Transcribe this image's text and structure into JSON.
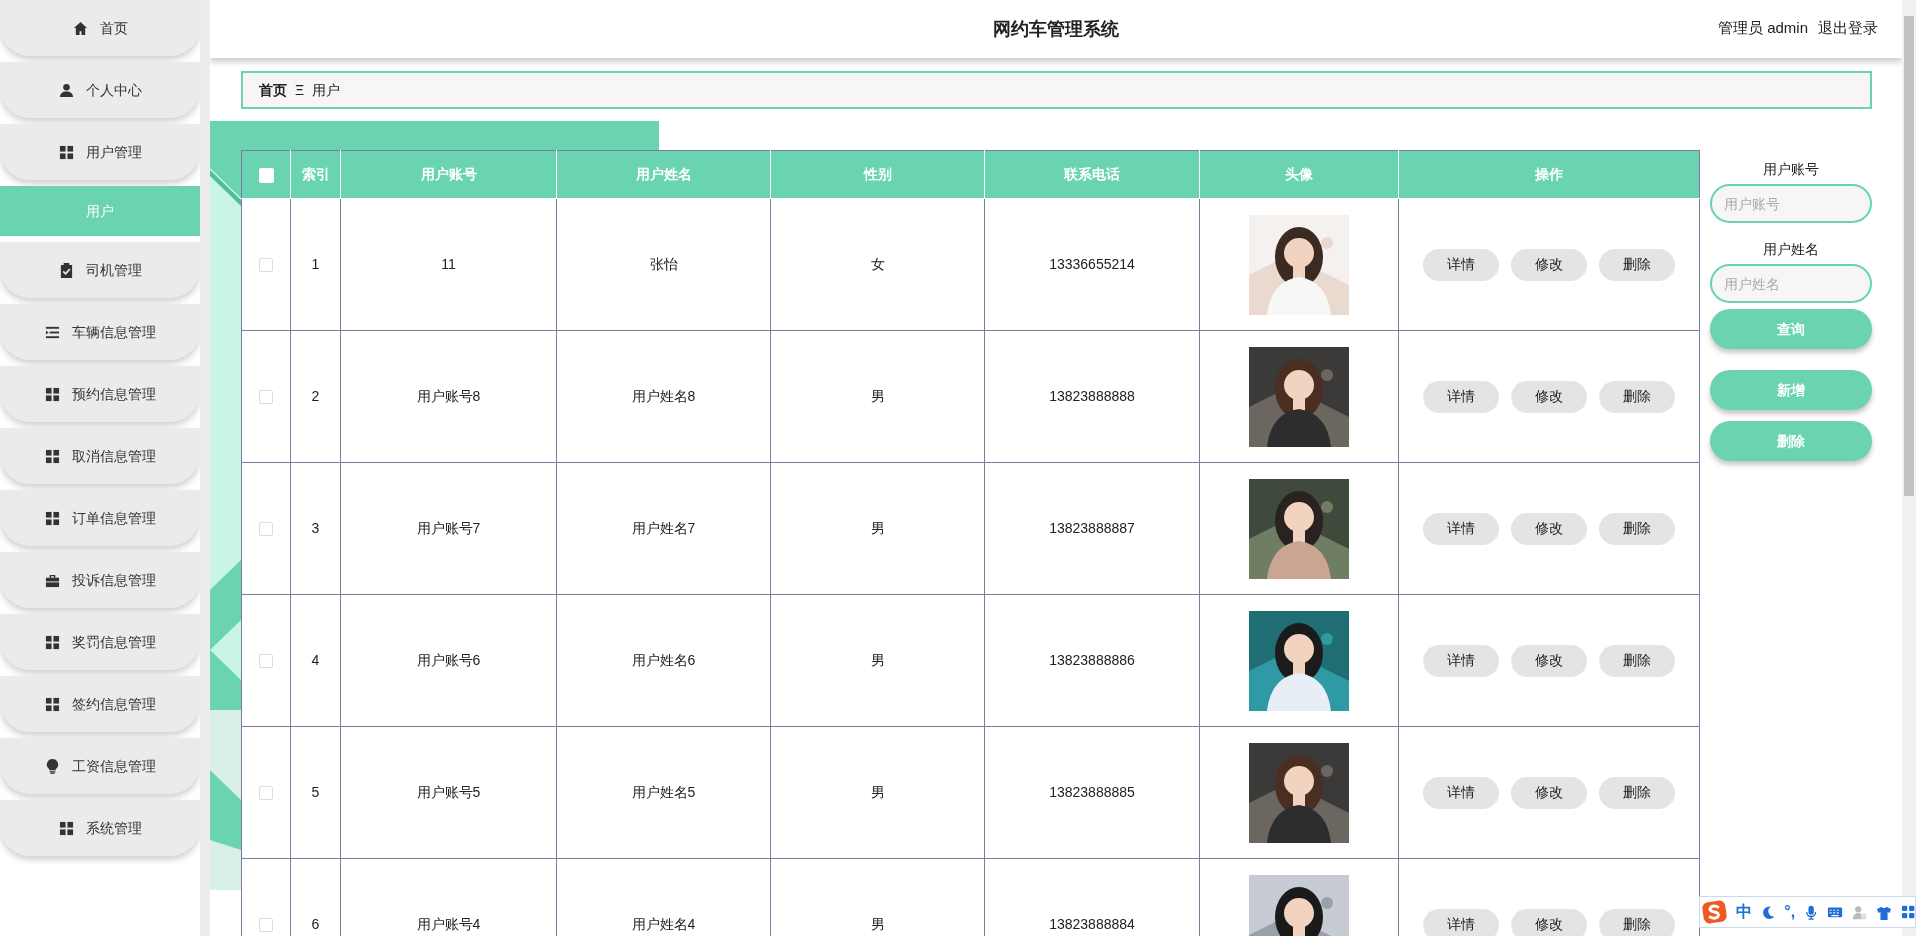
{
  "sidebar": {
    "items": [
      {
        "label": "首页",
        "kind": "home",
        "selected": false
      },
      {
        "label": "个人中心",
        "kind": "user",
        "selected": false
      },
      {
        "label": "用户管理",
        "kind": "grid",
        "selected": false
      },
      {
        "label": "用户",
        "kind": "sub",
        "selected": true
      },
      {
        "label": "司机管理",
        "kind": "clipboard",
        "selected": false
      },
      {
        "label": "车辆信息管理",
        "kind": "list",
        "selected": false
      },
      {
        "label": "预约信息管理",
        "kind": "grid",
        "selected": false
      },
      {
        "label": "取消信息管理",
        "kind": "grid",
        "selected": false
      },
      {
        "label": "订单信息管理",
        "kind": "grid",
        "selected": false
      },
      {
        "label": "投诉信息管理",
        "kind": "briefcase",
        "selected": false
      },
      {
        "label": "奖罚信息管理",
        "kind": "grid",
        "selected": false
      },
      {
        "label": "签约信息管理",
        "kind": "grid",
        "selected": false
      },
      {
        "label": "工资信息管理",
        "kind": "bulb",
        "selected": false
      },
      {
        "label": "系统管理",
        "kind": "grid",
        "selected": false
      }
    ]
  },
  "header": {
    "title": "网约车管理系统",
    "user": "管理员 admin",
    "logout": "退出登录"
  },
  "breadcrumb": {
    "home": "首页",
    "separator": "Ξ",
    "current": "用户"
  },
  "table": {
    "select_all": {
      "checked": false
    },
    "columns": [
      "索引",
      "用户账号",
      "用户姓名",
      "性别",
      "联系电话",
      "头像",
      "操作"
    ],
    "rows": [
      {
        "checked": false,
        "index": "1",
        "account": "11",
        "name": "张怡",
        "gender": "女",
        "phone": "13336655214",
        "actions": [
          "详情",
          "修改",
          "删除"
        ]
      },
      {
        "checked": false,
        "index": "2",
        "account": "用户账号8",
        "name": "用户姓名8",
        "gender": "男",
        "phone": "13823888888",
        "actions": [
          "详情",
          "修改",
          "删除"
        ]
      },
      {
        "checked": false,
        "index": "3",
        "account": "用户账号7",
        "name": "用户姓名7",
        "gender": "男",
        "phone": "13823888887",
        "actions": [
          "详情",
          "修改",
          "删除"
        ]
      },
      {
        "checked": false,
        "index": "4",
        "account": "用户账号6",
        "name": "用户姓名6",
        "gender": "男",
        "phone": "13823888886",
        "actions": [
          "详情",
          "修改",
          "删除"
        ]
      },
      {
        "checked": false,
        "index": "5",
        "account": "用户账号5",
        "name": "用户姓名5",
        "gender": "男",
        "phone": "13823888885",
        "actions": [
          "详情",
          "修改",
          "删除"
        ]
      },
      {
        "checked": false,
        "index": "6",
        "account": "用户账号4",
        "name": "用户姓名4",
        "gender": "男",
        "phone": "13823888884",
        "actions": [
          "详情",
          "修改",
          "删除"
        ]
      }
    ]
  },
  "search": {
    "fields": [
      {
        "label": "用户账号",
        "placeholder": "用户账号"
      },
      {
        "label": "用户姓名",
        "placeholder": "用户姓名"
      }
    ],
    "buttons": [
      "查询",
      "新增",
      "删除"
    ]
  },
  "ime_toolbar": {
    "items": [
      {
        "kind": "logo"
      },
      {
        "kind": "text",
        "label": "中"
      },
      {
        "kind": "moon"
      },
      {
        "kind": "text",
        "label": "°,"
      },
      {
        "kind": "mic"
      },
      {
        "kind": "keyboard"
      },
      {
        "kind": "person"
      },
      {
        "kind": "shirt"
      },
      {
        "kind": "grid"
      }
    ]
  }
}
